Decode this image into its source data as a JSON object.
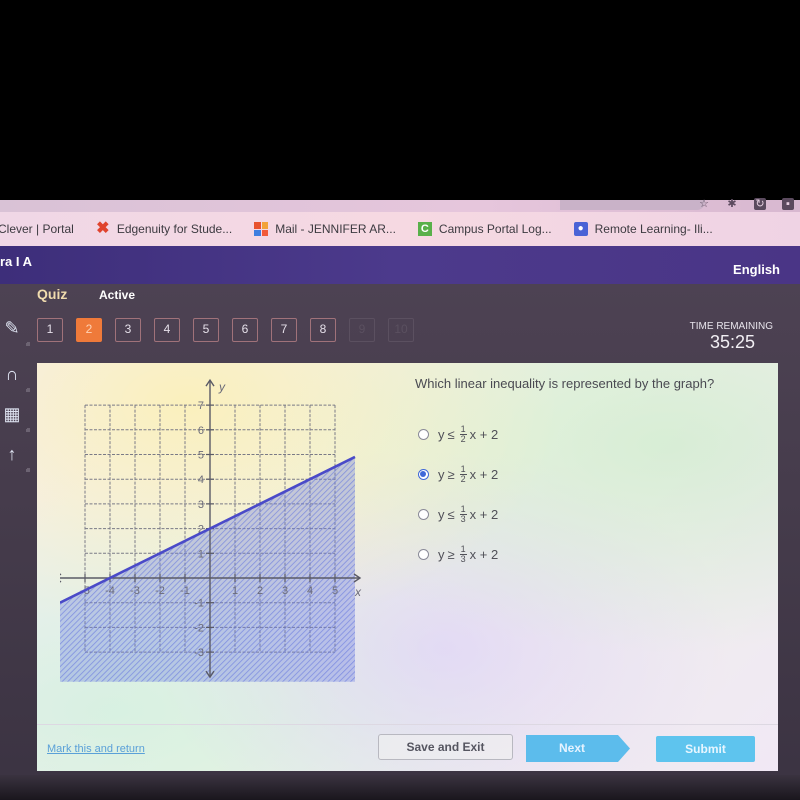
{
  "browser": {
    "bookmarks": [
      {
        "label": "Clever | Portal",
        "icon": "none"
      },
      {
        "label": "Edgenuity for Stude...",
        "icon": "edgenuity-x-icon"
      },
      {
        "label": "Mail - JENNIFER AR...",
        "icon": "microsoft-icon"
      },
      {
        "label": "Campus Portal Log...",
        "icon": "campus-c-icon"
      },
      {
        "label": "Remote Learning- Ili...",
        "icon": "user-card-icon"
      }
    ],
    "toolbar_icons": [
      "bookmark-star-icon",
      "extension-puzzle-icon",
      "refresh-icon",
      "profile-icon"
    ]
  },
  "header": {
    "title": "ra I A",
    "language": "English"
  },
  "quiz": {
    "label": "Quiz",
    "status": "Active",
    "questions": [
      {
        "num": "1",
        "state": "default"
      },
      {
        "num": "2",
        "state": "current"
      },
      {
        "num": "3",
        "state": "default"
      },
      {
        "num": "4",
        "state": "default"
      },
      {
        "num": "5",
        "state": "default"
      },
      {
        "num": "6",
        "state": "default"
      },
      {
        "num": "7",
        "state": "default"
      },
      {
        "num": "8",
        "state": "default"
      },
      {
        "num": "9",
        "state": "disabled"
      },
      {
        "num": "10",
        "state": "disabled"
      }
    ],
    "time_label": "TIME REMAINING",
    "time_value": "35:25"
  },
  "tools": [
    "pencil-icon",
    "headphones-icon",
    "calculator-icon",
    "reference-arrow-icon"
  ],
  "question": {
    "text": "Which linear inequality is represented by the graph?",
    "options": [
      {
        "lhs": "y",
        "symbol": "≤",
        "num": "1",
        "den": "2",
        "rest": "x + 2",
        "selected": false
      },
      {
        "lhs": "y",
        "symbol": "≥",
        "num": "1",
        "den": "2",
        "rest": "x + 2",
        "selected": true
      },
      {
        "lhs": "y",
        "symbol": "≤",
        "num": "1",
        "den": "3",
        "rest": "x + 2",
        "selected": false
      },
      {
        "lhs": "y",
        "symbol": "≥",
        "num": "1",
        "den": "3",
        "rest": "x + 2",
        "selected": false
      }
    ]
  },
  "graph": {
    "x_label": "x",
    "y_label": "y",
    "x_range": [
      -5,
      5
    ],
    "y_range": [
      -3,
      7
    ],
    "x_ticks": [
      "-5",
      "-4",
      "-3",
      "-2",
      "-1",
      "1",
      "2",
      "3",
      "4",
      "5"
    ],
    "y_ticks": [
      "-3",
      "-2",
      "-1",
      "1",
      "2",
      "3",
      "4",
      "5",
      "6",
      "7"
    ],
    "line": {
      "slope": 0.5,
      "intercept": 2,
      "style": "solid"
    },
    "shading": "below",
    "line_color": "#4a4ac8",
    "shade_color": "#6a7ae0"
  },
  "footer": {
    "mark_label": "Mark this and return",
    "save_label": "Save and Exit",
    "next_label": "Next",
    "submit_label": "Submit"
  },
  "colors": {
    "header_bg": "#4c3a8c",
    "current_question": "#ef7a3a",
    "accent_blue": "#5ec4ee",
    "radio_selected": "#3f68d8"
  }
}
